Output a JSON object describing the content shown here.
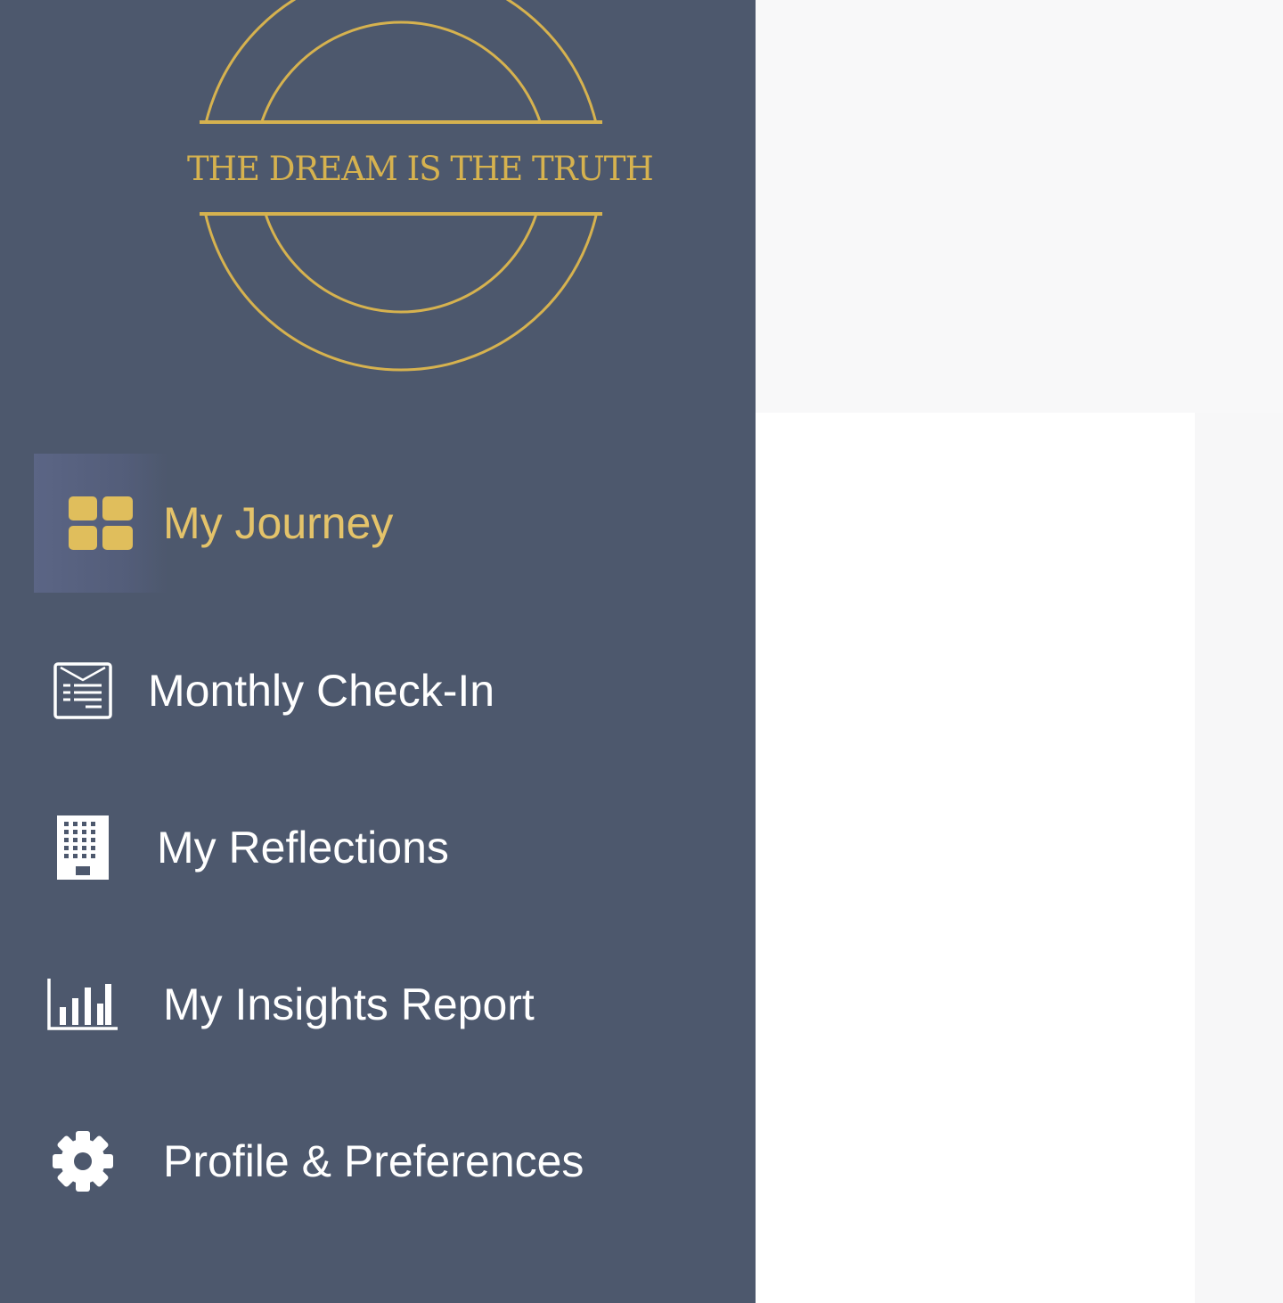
{
  "logo": {
    "tagline": "THE DREAM IS THE TRUTH",
    "color": "#d6b24f"
  },
  "sidebar": {
    "background": "#4d586d",
    "items": [
      {
        "label": "My Journey",
        "icon": "dashboard-grid-icon",
        "active": true
      },
      {
        "label": "Monthly Check-In",
        "icon": "checklist-calendar-icon",
        "active": false
      },
      {
        "label": "My Reflections",
        "icon": "building-icon",
        "active": false
      },
      {
        "label": "My Insights Report",
        "icon": "bar-chart-icon",
        "active": false
      },
      {
        "label": "Profile & Preferences",
        "icon": "gear-icon",
        "active": false
      }
    ]
  },
  "colors": {
    "accent": "#e4c36a",
    "text": "#ffffff"
  }
}
